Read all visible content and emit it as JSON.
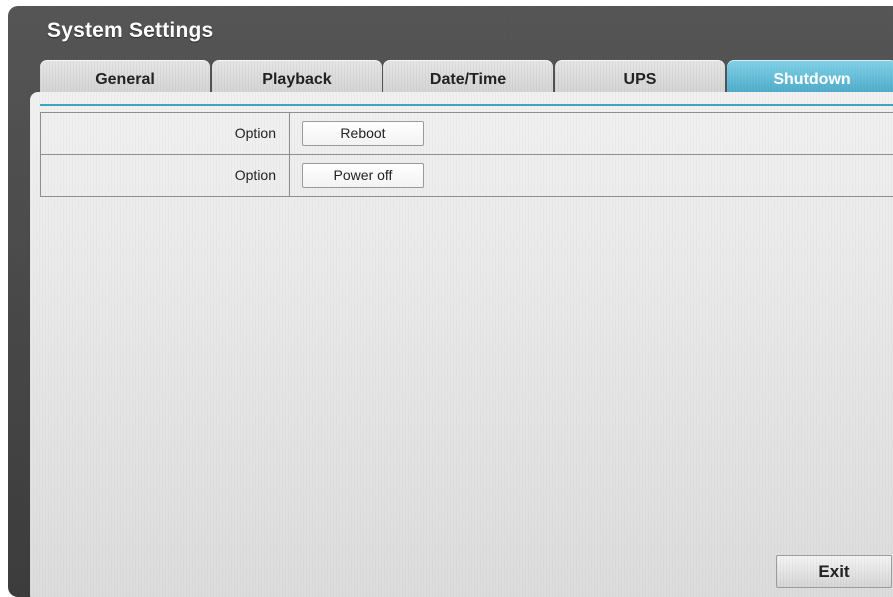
{
  "window": {
    "title": "System Settings"
  },
  "tabs": [
    {
      "label": "General",
      "active": false
    },
    {
      "label": "Playback",
      "active": false
    },
    {
      "label": "Date/Time",
      "active": false
    },
    {
      "label": "UPS",
      "active": false
    },
    {
      "label": "Shutdown",
      "active": true
    }
  ],
  "options": [
    {
      "label": "Option",
      "button": "Reboot"
    },
    {
      "label": "Option",
      "button": "Power off"
    }
  ],
  "footer": {
    "exit_label": "Exit"
  },
  "colors": {
    "accent": "#4aa8c8",
    "frame": "#4a4a4a",
    "panel": "#e6e6e6"
  }
}
